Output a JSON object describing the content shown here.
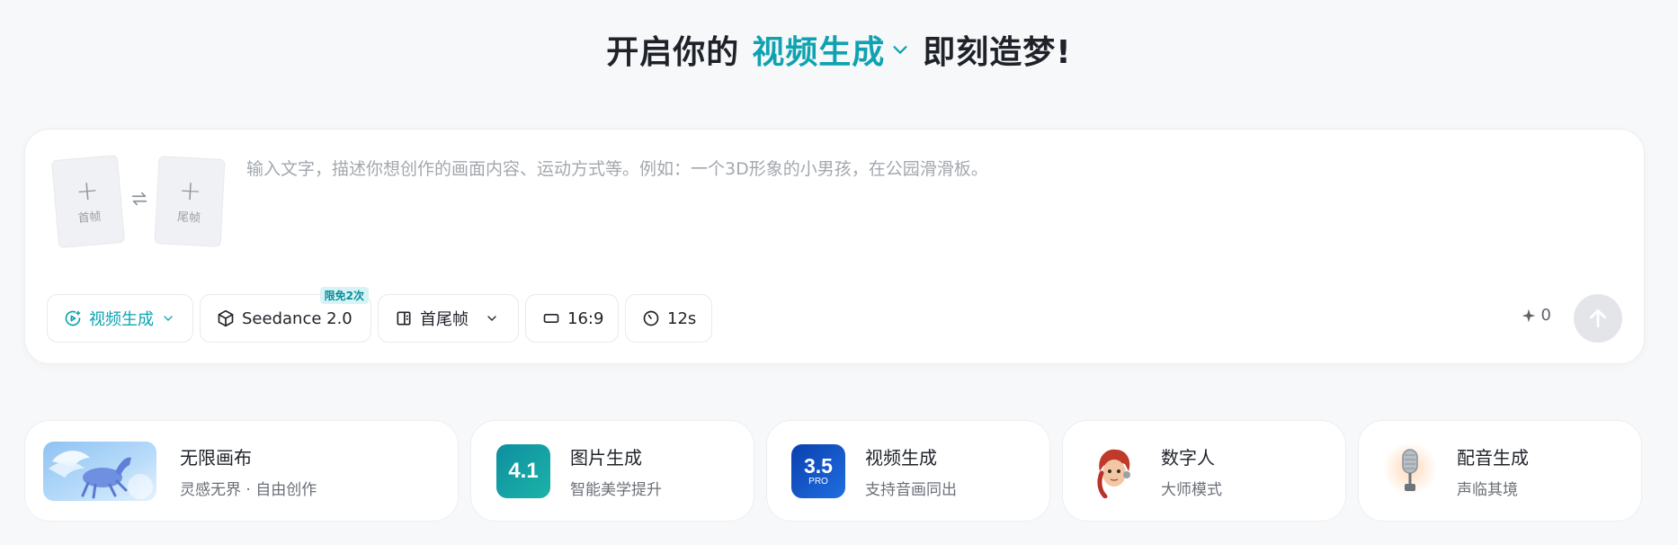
{
  "hero": {
    "prefix": "开启你的",
    "mode": "视频生成",
    "suffix": "即刻造梦!"
  },
  "composer": {
    "first_frame_label": "首帧",
    "last_frame_label": "尾帧",
    "prompt_placeholder": "输入文字，描述你想创作的画面内容、运动方式等。例如：一个3D形象的小男孩，在公园滑滑板。",
    "prompt_value": ""
  },
  "toolbar": {
    "mode_label": "视频生成",
    "model_label": "Seedance 2.0",
    "model_badge": "限免2次",
    "frame_mode_label": "首尾帧",
    "ratio_label": "16:9",
    "duration_label": "12s"
  },
  "credits": {
    "count": "0"
  },
  "features": [
    {
      "title": "无限画布",
      "desc": "灵感无界 · 自由创作",
      "icon": "pegasus-canvas-image"
    },
    {
      "title": "图片生成",
      "desc": "智能美学提升",
      "icon": "image-model-4.1-logo",
      "logo_text": "4.1"
    },
    {
      "title": "视频生成",
      "desc": "支持音画同出",
      "icon": "video-model-3.5-pro-logo",
      "logo_text": "3.5",
      "logo_sub": "PRO"
    },
    {
      "title": "数字人",
      "desc": "大师模式",
      "icon": "digital-human-avatar"
    },
    {
      "title": "配音生成",
      "desc": "声临其境",
      "icon": "microphone-image"
    }
  ],
  "colors": {
    "accent": "#0fa3b1",
    "background": "#f7f8fa",
    "card": "#ffffff",
    "send_disabled": "#e4e5e8"
  }
}
